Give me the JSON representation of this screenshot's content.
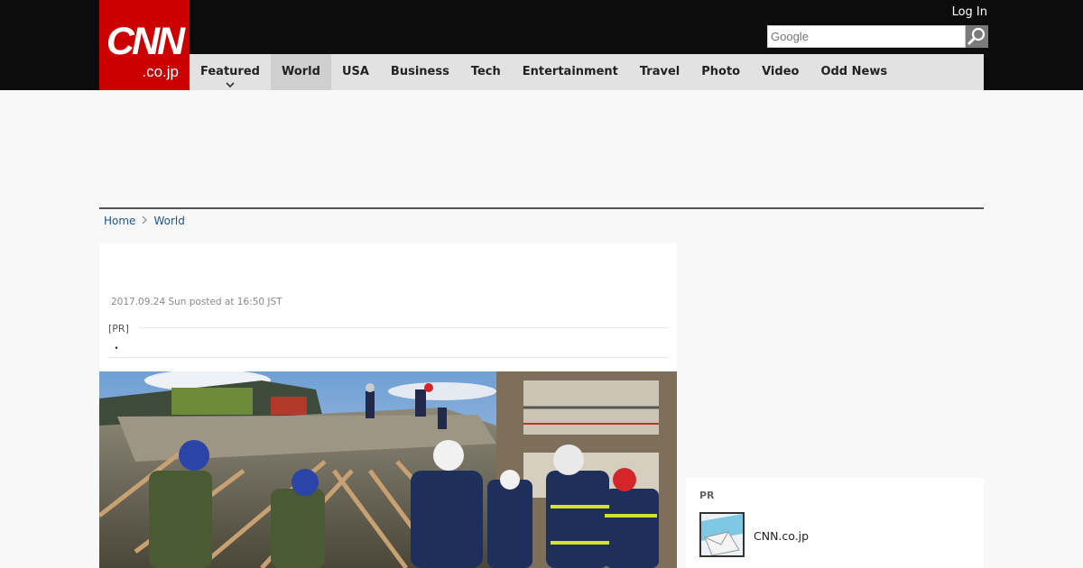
{
  "header": {
    "logo_main": "CNN",
    "logo_sub": ".co.jp",
    "login_label": "Log In",
    "search_placeholder": "Google"
  },
  "nav": {
    "items": [
      {
        "label": "Featured"
      },
      {
        "label": "World"
      },
      {
        "label": "USA"
      },
      {
        "label": "Business"
      },
      {
        "label": "Tech"
      },
      {
        "label": "Entertainment"
      },
      {
        "label": "Travel"
      },
      {
        "label": "Photo"
      },
      {
        "label": "Video"
      },
      {
        "label": "Odd News"
      }
    ]
  },
  "breadcrumb": {
    "home": "Home",
    "separator": "›",
    "section": "World"
  },
  "article": {
    "date": "2017.09.24 Sun posted at 16:50 JST",
    "pr_label": "[PR]",
    "pr_text": "・"
  },
  "sidebar": {
    "pr_label": "PR",
    "link_text": "CNN.co.jp"
  },
  "colors": {
    "brand_red": "#cc0000",
    "header_bg": "#0c0c0c",
    "nav_bg": "#e2e2e2",
    "link_blue": "#1a5590"
  }
}
